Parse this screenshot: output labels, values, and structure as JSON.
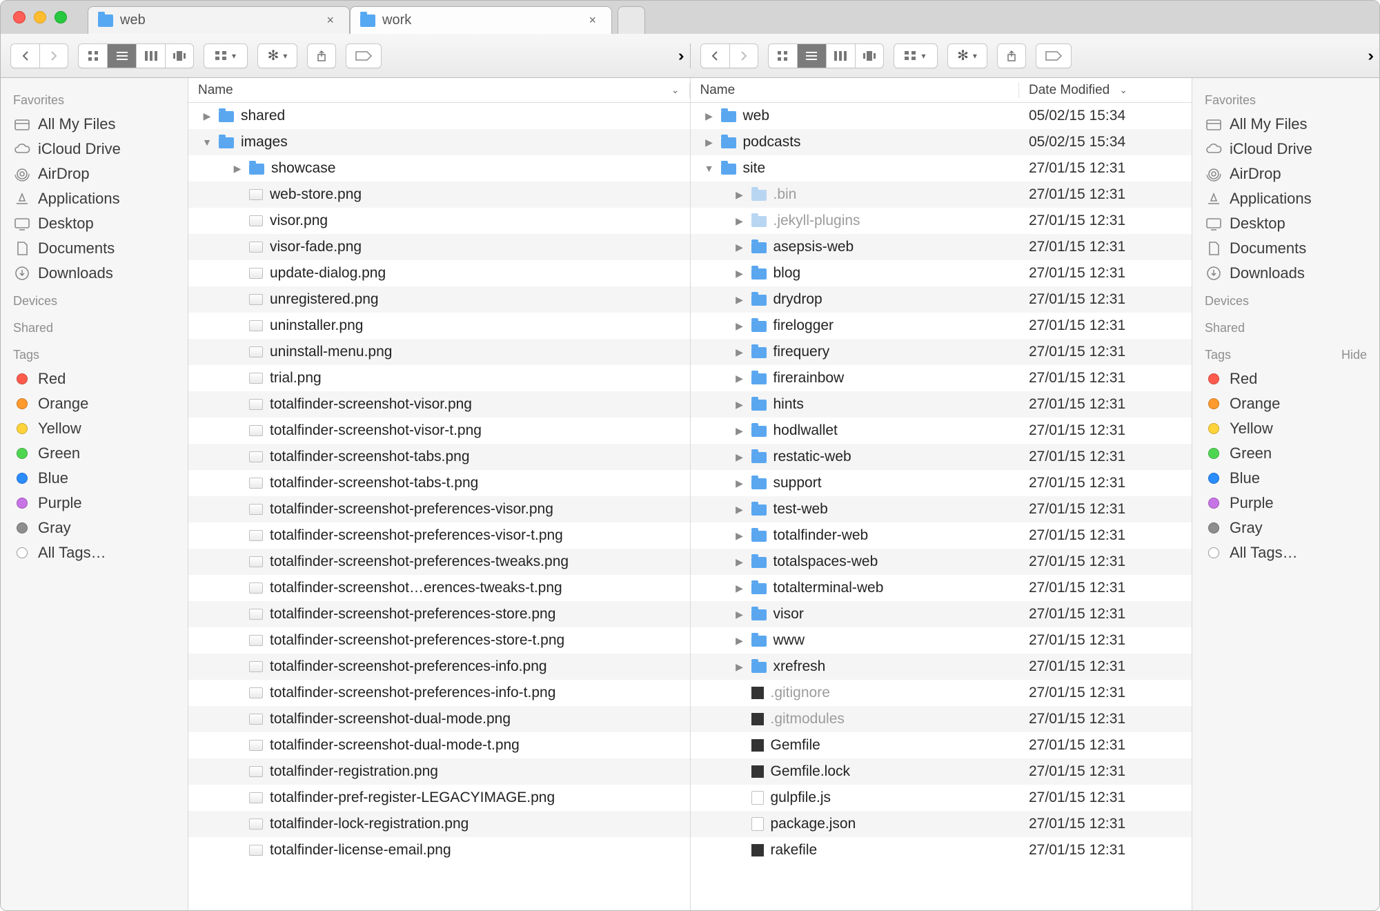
{
  "tabs": [
    {
      "label": "web",
      "active": true
    },
    {
      "label": "work",
      "active": false
    }
  ],
  "sidebar": {
    "favorites_header": "Favorites",
    "devices_header": "Devices",
    "shared_header": "Shared",
    "tags_header": "Tags",
    "hide_label": "Hide",
    "favorites": [
      {
        "label": "All My Files",
        "icon": "allfiles"
      },
      {
        "label": "iCloud Drive",
        "icon": "icloud"
      },
      {
        "label": "AirDrop",
        "icon": "airdrop"
      },
      {
        "label": "Applications",
        "icon": "apps"
      },
      {
        "label": "Desktop",
        "icon": "desktop"
      },
      {
        "label": "Documents",
        "icon": "documents"
      },
      {
        "label": "Downloads",
        "icon": "downloads"
      }
    ],
    "tags": [
      {
        "label": "Red",
        "color": "#ff5b4d"
      },
      {
        "label": "Orange",
        "color": "#ff9a2e"
      },
      {
        "label": "Yellow",
        "color": "#ffd33a"
      },
      {
        "label": "Green",
        "color": "#4fd651"
      },
      {
        "label": "Blue",
        "color": "#2a8cff"
      },
      {
        "label": "Purple",
        "color": "#c774e6"
      },
      {
        "label": "Gray",
        "color": "#8e8e8e"
      },
      {
        "label": "All Tags…",
        "color": null
      }
    ]
  },
  "leftPane": {
    "columns": {
      "name": "Name"
    },
    "rows": [
      {
        "indent": 0,
        "disclosure": "right",
        "type": "folder",
        "name": "shared"
      },
      {
        "indent": 0,
        "disclosure": "down",
        "type": "folder",
        "name": "images"
      },
      {
        "indent": 1,
        "disclosure": "right",
        "type": "folder",
        "name": "showcase"
      },
      {
        "indent": 1,
        "disclosure": "",
        "type": "img",
        "name": "web-store.png"
      },
      {
        "indent": 1,
        "disclosure": "",
        "type": "img",
        "name": "visor.png"
      },
      {
        "indent": 1,
        "disclosure": "",
        "type": "img",
        "name": "visor-fade.png"
      },
      {
        "indent": 1,
        "disclosure": "",
        "type": "img",
        "name": "update-dialog.png"
      },
      {
        "indent": 1,
        "disclosure": "",
        "type": "img",
        "name": "unregistered.png"
      },
      {
        "indent": 1,
        "disclosure": "",
        "type": "img",
        "name": "uninstaller.png"
      },
      {
        "indent": 1,
        "disclosure": "",
        "type": "img",
        "name": "uninstall-menu.png"
      },
      {
        "indent": 1,
        "disclosure": "",
        "type": "img",
        "name": "trial.png"
      },
      {
        "indent": 1,
        "disclosure": "",
        "type": "img",
        "name": "totalfinder-screenshot-visor.png"
      },
      {
        "indent": 1,
        "disclosure": "",
        "type": "img",
        "name": "totalfinder-screenshot-visor-t.png"
      },
      {
        "indent": 1,
        "disclosure": "",
        "type": "img",
        "name": "totalfinder-screenshot-tabs.png"
      },
      {
        "indent": 1,
        "disclosure": "",
        "type": "img",
        "name": "totalfinder-screenshot-tabs-t.png"
      },
      {
        "indent": 1,
        "disclosure": "",
        "type": "img",
        "name": "totalfinder-screenshot-preferences-visor.png"
      },
      {
        "indent": 1,
        "disclosure": "",
        "type": "img",
        "name": "totalfinder-screenshot-preferences-visor-t.png"
      },
      {
        "indent": 1,
        "disclosure": "",
        "type": "img",
        "name": "totalfinder-screenshot-preferences-tweaks.png"
      },
      {
        "indent": 1,
        "disclosure": "",
        "type": "img",
        "name": "totalfinder-screenshot…erences-tweaks-t.png"
      },
      {
        "indent": 1,
        "disclosure": "",
        "type": "img",
        "name": "totalfinder-screenshot-preferences-store.png"
      },
      {
        "indent": 1,
        "disclosure": "",
        "type": "img",
        "name": "totalfinder-screenshot-preferences-store-t.png"
      },
      {
        "indent": 1,
        "disclosure": "",
        "type": "img",
        "name": "totalfinder-screenshot-preferences-info.png"
      },
      {
        "indent": 1,
        "disclosure": "",
        "type": "img",
        "name": "totalfinder-screenshot-preferences-info-t.png"
      },
      {
        "indent": 1,
        "disclosure": "",
        "type": "img",
        "name": "totalfinder-screenshot-dual-mode.png"
      },
      {
        "indent": 1,
        "disclosure": "",
        "type": "img",
        "name": "totalfinder-screenshot-dual-mode-t.png"
      },
      {
        "indent": 1,
        "disclosure": "",
        "type": "img",
        "name": "totalfinder-registration.png"
      },
      {
        "indent": 1,
        "disclosure": "",
        "type": "img",
        "name": "totalfinder-pref-register-LEGACYIMAGE.png"
      },
      {
        "indent": 1,
        "disclosure": "",
        "type": "img",
        "name": "totalfinder-lock-registration.png"
      },
      {
        "indent": 1,
        "disclosure": "",
        "type": "img",
        "name": "totalfinder-license-email.png"
      }
    ]
  },
  "rightPane": {
    "columns": {
      "name": "Name",
      "date": "Date Modified"
    },
    "rows": [
      {
        "indent": 0,
        "disclosure": "right",
        "type": "folder",
        "name": "web",
        "date": "05/02/15 15:34"
      },
      {
        "indent": 0,
        "disclosure": "right",
        "type": "folder",
        "name": "podcasts",
        "date": "05/02/15 15:34"
      },
      {
        "indent": 0,
        "disclosure": "down",
        "type": "folder",
        "name": "site",
        "date": "27/01/15 12:31"
      },
      {
        "indent": 1,
        "disclosure": "right",
        "type": "folder-dim",
        "name": ".bin",
        "dim": true,
        "date": "27/01/15 12:31"
      },
      {
        "indent": 1,
        "disclosure": "right",
        "type": "folder-dim",
        "name": ".jekyll-plugins",
        "dim": true,
        "date": "27/01/15 12:31"
      },
      {
        "indent": 1,
        "disclosure": "right",
        "type": "folder",
        "name": "asepsis-web",
        "date": "27/01/15 12:31"
      },
      {
        "indent": 1,
        "disclosure": "right",
        "type": "folder",
        "name": "blog",
        "date": "27/01/15 12:31"
      },
      {
        "indent": 1,
        "disclosure": "right",
        "type": "folder",
        "name": "drydrop",
        "date": "27/01/15 12:31"
      },
      {
        "indent": 1,
        "disclosure": "right",
        "type": "folder",
        "name": "firelogger",
        "date": "27/01/15 12:31"
      },
      {
        "indent": 1,
        "disclosure": "right",
        "type": "folder",
        "name": "firequery",
        "date": "27/01/15 12:31"
      },
      {
        "indent": 1,
        "disclosure": "right",
        "type": "folder",
        "name": "firerainbow",
        "date": "27/01/15 12:31"
      },
      {
        "indent": 1,
        "disclosure": "right",
        "type": "folder",
        "name": "hints",
        "date": "27/01/15 12:31"
      },
      {
        "indent": 1,
        "disclosure": "right",
        "type": "folder",
        "name": "hodlwallet",
        "date": "27/01/15 12:31"
      },
      {
        "indent": 1,
        "disclosure": "right",
        "type": "folder",
        "name": "restatic-web",
        "date": "27/01/15 12:31"
      },
      {
        "indent": 1,
        "disclosure": "right",
        "type": "folder",
        "name": "support",
        "date": "27/01/15 12:31"
      },
      {
        "indent": 1,
        "disclosure": "right",
        "type": "folder",
        "name": "test-web",
        "date": "27/01/15 12:31"
      },
      {
        "indent": 1,
        "disclosure": "right",
        "type": "folder",
        "name": "totalfinder-web",
        "date": "27/01/15 12:31"
      },
      {
        "indent": 1,
        "disclosure": "right",
        "type": "folder",
        "name": "totalspaces-web",
        "date": "27/01/15 12:31"
      },
      {
        "indent": 1,
        "disclosure": "right",
        "type": "folder",
        "name": "totalterminal-web",
        "date": "27/01/15 12:31"
      },
      {
        "indent": 1,
        "disclosure": "right",
        "type": "folder",
        "name": "visor",
        "date": "27/01/15 12:31"
      },
      {
        "indent": 1,
        "disclosure": "right",
        "type": "folder",
        "name": "www",
        "date": "27/01/15 12:31"
      },
      {
        "indent": 1,
        "disclosure": "right",
        "type": "folder",
        "name": "xrefresh",
        "date": "27/01/15 12:31"
      },
      {
        "indent": 1,
        "disclosure": "",
        "type": "dark",
        "name": ".gitignore",
        "dim": true,
        "date": "27/01/15 12:31"
      },
      {
        "indent": 1,
        "disclosure": "",
        "type": "dark",
        "name": ".gitmodules",
        "dim": true,
        "date": "27/01/15 12:31"
      },
      {
        "indent": 1,
        "disclosure": "",
        "type": "dark",
        "name": "Gemfile",
        "date": "27/01/15 12:31"
      },
      {
        "indent": 1,
        "disclosure": "",
        "type": "dark",
        "name": "Gemfile.lock",
        "date": "27/01/15 12:31"
      },
      {
        "indent": 1,
        "disclosure": "",
        "type": "file",
        "name": "gulpfile.js",
        "date": "27/01/15 12:31"
      },
      {
        "indent": 1,
        "disclosure": "",
        "type": "file",
        "name": "package.json",
        "date": "27/01/15 12:31"
      },
      {
        "indent": 1,
        "disclosure": "",
        "type": "dark",
        "name": "rakefile",
        "date": "27/01/15 12:31"
      }
    ]
  }
}
